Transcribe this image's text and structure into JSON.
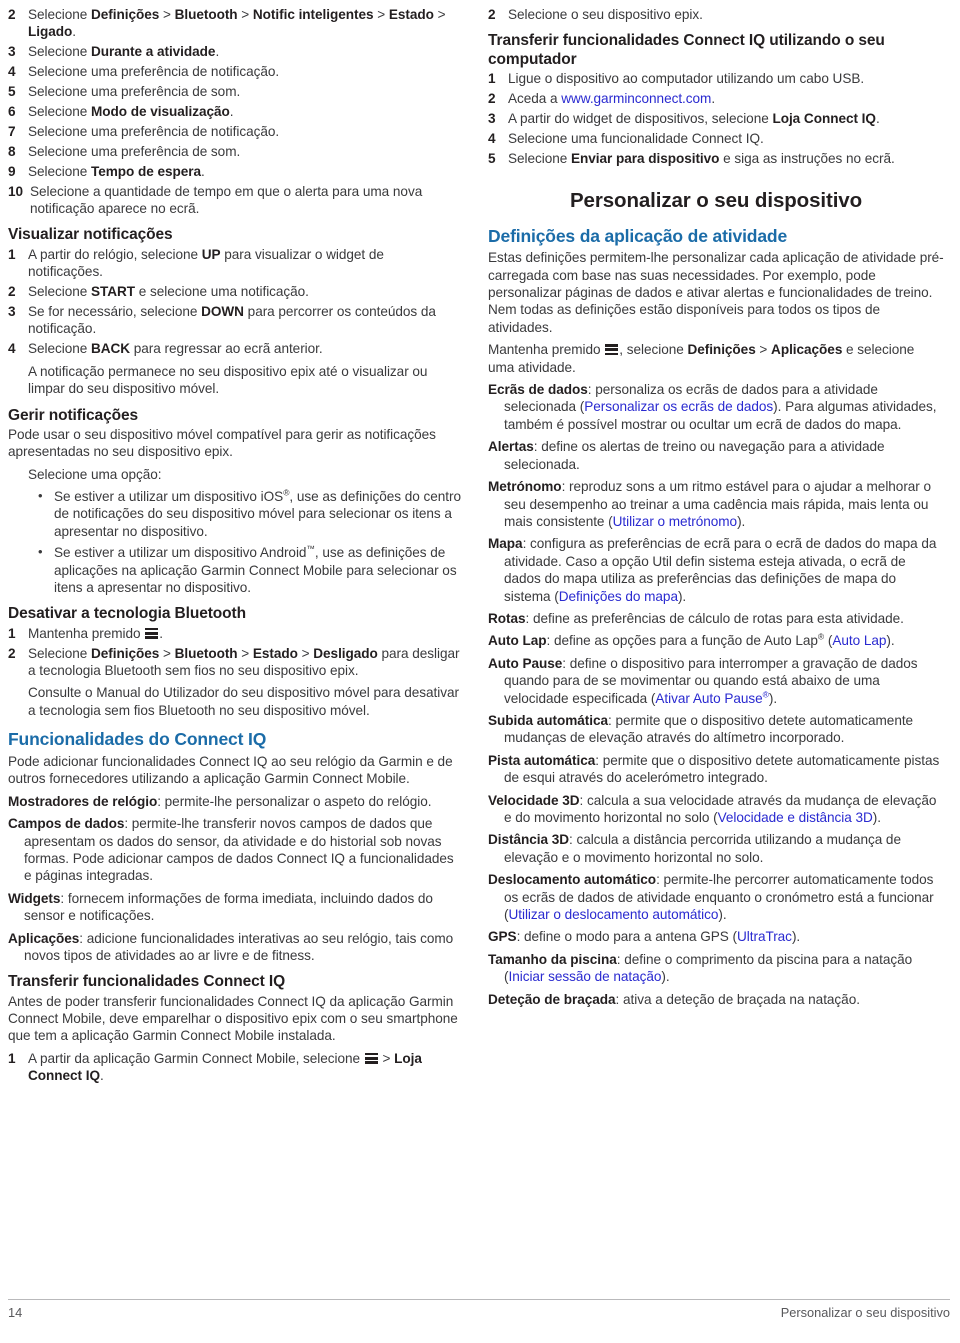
{
  "document": {
    "page_number": "14",
    "running_header": "Personalizar o seu dispositivo",
    "accent_blue": "#1b6ca8",
    "link_blue": "#2a2ad0",
    "body_color": "#3a3a3c"
  },
  "left_column": {
    "smart_notifications_steps": [
      {
        "num": "2",
        "html": "Selecione <b>Definições</b> &gt; <b>Bluetooth</b> &gt; <b>Notific inteligentes</b> &gt; <b>Estado</b> &gt; <b>Ligado</b>."
      },
      {
        "num": "3",
        "html": "Selecione <b>Durante a atividade</b>."
      },
      {
        "num": "4",
        "html": "Selecione uma preferência de notificação."
      },
      {
        "num": "5",
        "html": "Selecione uma preferência de som."
      },
      {
        "num": "6",
        "html": "Selecione <b>Modo de visualização</b>."
      },
      {
        "num": "7",
        "html": "Selecione uma preferência de notificação."
      },
      {
        "num": "8",
        "html": "Selecione uma preferência de som."
      },
      {
        "num": "9",
        "html": "Selecione <b>Tempo de espera</b>."
      },
      {
        "num": "10",
        "html": "Selecione a quantidade de tempo em que o alerta para uma nova notificação aparece no ecrã."
      }
    ],
    "view_notifications": {
      "heading": "Visualizar notificações",
      "steps": [
        {
          "num": "1",
          "html": "A partir do relógio, selecione <b>UP</b> para visualizar o widget de notificações."
        },
        {
          "num": "2",
          "html": "Selecione <b>START</b> e selecione uma notificação."
        },
        {
          "num": "3",
          "html": "Se for necessário, selecione <b>DOWN</b> para percorrer os conteúdos da notificação."
        },
        {
          "num": "4",
          "html": "Selecione <b>BACK</b> para regressar ao ecrã anterior."
        }
      ],
      "note": "A notificação permanece no seu dispositivo epix até o visualizar ou limpar do seu dispositivo móvel."
    },
    "manage_notifications": {
      "heading": "Gerir notificações",
      "intro": "Pode usar o seu dispositivo móvel compatível para gerir as notificações apresentadas no seu dispositivo epix.",
      "choose_option": "Selecione uma opção:",
      "bullets": [
        "Se estiver a utilizar um dispositivo iOS<sup class=\"sup\">®</sup>, use as definições do centro de notificações do seu dispositivo móvel para selecionar os itens a apresentar no dispositivo.",
        "Se estiver a utilizar um dispositivo Android<sup class=\"sup\">™</sup>, use as definições de aplicações na aplicação Garmin Connect Mobile para selecionar os itens a apresentar no dispositivo."
      ]
    },
    "disable_bluetooth": {
      "heading": "Desativar a tecnologia Bluetooth",
      "steps": [
        {
          "num": "1",
          "html": "Mantenha premido <span class=\"menu-icon\" data-name=\"menu-icon\"><i></i><i></i><i></i></span>."
        },
        {
          "num": "2",
          "html": "Selecione <b>Definições</b> &gt; <b>Bluetooth</b> &gt; <b>Estado</b> &gt; <b>Desligado</b> para desligar a tecnologia Bluetooth sem fios no seu dispositivo epix."
        }
      ],
      "note": "Consulte o Manual do Utilizador do seu dispositivo móvel para desativar a tecnologia sem fios Bluetooth no seu dispositivo móvel."
    },
    "connect_iq": {
      "heading": "Funcionalidades do Connect IQ",
      "intro": "Pode adicionar funcionalidades Connect IQ ao seu relógio da Garmin e de outros fornecedores utilizando a aplicação Garmin Connect Mobile.",
      "definitions": [
        {
          "term": "Mostradores de relógio",
          "desc": ": permite-lhe personalizar o aspeto do relógio."
        },
        {
          "term": "Campos de dados",
          "desc": ": permite-lhe transferir novos campos de dados que apresentam os dados do sensor, da atividade e do historial sob novas formas. Pode adicionar campos de dados Connect IQ a funcionalidades e páginas integradas."
        },
        {
          "term": "Widgets",
          "desc": ": fornecem informações de forma imediata, incluindo dados do sensor e notificações."
        },
        {
          "term": "Aplicações",
          "desc": ": adicione funcionalidades interativas ao seu relógio, tais como novos tipos de atividades ao ar livre e de fitness."
        }
      ]
    },
    "transfer_connect_iq": {
      "heading": "Transferir funcionalidades Connect IQ",
      "intro": "Antes de poder transferir funcionalidades Connect IQ da aplicação Garmin Connect Mobile, deve emparelhar o dispositivo epix com o seu smartphone que tem a aplicação Garmin Connect Mobile instalada.",
      "steps": [
        {
          "num": "1",
          "html": "A partir da aplicação Garmin Connect Mobile, selecione <span class=\"menu-icon\" data-name=\"menu-icon\"><i></i><i></i><i></i></span> &gt; <b>Loja Connect IQ</b>."
        }
      ]
    }
  },
  "right_column": {
    "continued_steps": [
      {
        "num": "2",
        "html": "Selecione o seu dispositivo epix."
      }
    ],
    "transfer_via_computer": {
      "heading": "Transferir funcionalidades Connect IQ utilizando o seu computador",
      "steps": [
        {
          "num": "1",
          "html": "Ligue o dispositivo ao computador utilizando um cabo USB."
        },
        {
          "num": "2",
          "html": "Aceda a <span class=\"weblink\">www.garminconnect.com</span>."
        },
        {
          "num": "3",
          "html": "A partir do widget de dispositivos, selecione <b>Loja Connect IQ</b>."
        },
        {
          "num": "4",
          "html": "Selecione uma funcionalidade Connect IQ."
        },
        {
          "num": "5",
          "html": "Selecione <b>Enviar para dispositivo</b> e siga as instruções no ecrã."
        }
      ]
    },
    "chapter_title": "Personalizar o seu dispositivo",
    "activity_app_settings": {
      "heading": "Definições da aplicação de atividade",
      "intro": "Estas definições permitem-lhe personalizar cada aplicação de atividade pré-carregada com base nas suas necessidades. Por exemplo, pode personalizar páginas de dados e ativar alertas e funcionalidades de treino. Nem todas as definições estão disponíveis para todos os tipos de atividades.",
      "instruction": "Mantenha premido <span class=\"menu-icon\" data-name=\"menu-icon\"><i></i><i></i><i></i></span>, selecione <b>Definições</b> &gt; <b>Aplicações</b> e selecione uma atividade.",
      "definitions": [
        {
          "term": "Ecrãs de dados",
          "desc": ": personaliza os ecrãs de dados para a atividade selecionada (<span class=\"xref\">Personalizar os ecrãs de dados</span>). Para algumas atividades, também é possível mostrar ou ocultar um ecrã de dados do mapa."
        },
        {
          "term": "Alertas",
          "desc": ": define os alertas de treino ou navegação para a atividade selecionada."
        },
        {
          "term": "Metrónomo",
          "desc": ": reproduz sons a um ritmo estável para o ajudar a melhorar o seu desempenho ao treinar a uma cadência mais rápida, mais lenta ou mais consistente (<span class=\"xref\">Utilizar o metrónomo</span>)."
        },
        {
          "term": "Mapa",
          "desc": ": configura as preferências de ecrã para o ecrã de dados do mapa da atividade. Caso a opção Util defin sistema esteja ativada, o ecrã de dados do mapa utiliza as preferências das definições de mapa do sistema (<span class=\"xref\">Definições do mapa</span>)."
        },
        {
          "term": "Rotas",
          "desc": ": define as preferências de cálculo de rotas para esta atividade."
        },
        {
          "term": "Auto Lap",
          "desc": ": define as opções para a função de Auto Lap<sup class=\"sup\">®</sup> (<span class=\"xref\">Auto Lap</span>)."
        },
        {
          "term": "Auto Pause",
          "desc": ": define o dispositivo para interromper a gravação de dados quando para de se movimentar ou quando está abaixo de uma velocidade especificada (<span class=\"xref\">Ativar Auto Pause<sup class=\"sup\">®</sup></span>)."
        },
        {
          "term": "Subida automática",
          "desc": ": permite que o dispositivo detete automaticamente mudanças de elevação através do altímetro incorporado."
        },
        {
          "term": "Pista automática",
          "desc": ": permite que o dispositivo detete automaticamente pistas de esqui através do acelerómetro integrado."
        },
        {
          "term": "Velocidade 3D",
          "desc": ": calcula a sua velocidade através da mudança de elevação e do movimento horizontal no solo (<span class=\"xref\">Velocidade e distância 3D</span>)."
        },
        {
          "term": "Distância 3D",
          "desc": ": calcula a distância percorrida utilizando a mudança de elevação e o movimento horizontal no solo."
        },
        {
          "term": "Deslocamento automático",
          "desc": ": permite-lhe percorrer automaticamente todos os ecrãs de dados de atividade enquanto o cronómetro está a funcionar (<span class=\"xref\">Utilizar o deslocamento automático</span>)."
        },
        {
          "term": "GPS",
          "desc": ": define o modo para a antena GPS (<span class=\"xref\">UltraTrac</span>)."
        },
        {
          "term": "Tamanho da piscina",
          "desc": ": define o comprimento da piscina para a natação (<span class=\"xref\">Iniciar sessão de natação</span>)."
        },
        {
          "term": "Deteção de braçada",
          "desc": ": ativa a deteção de braçada na natação."
        }
      ]
    }
  }
}
